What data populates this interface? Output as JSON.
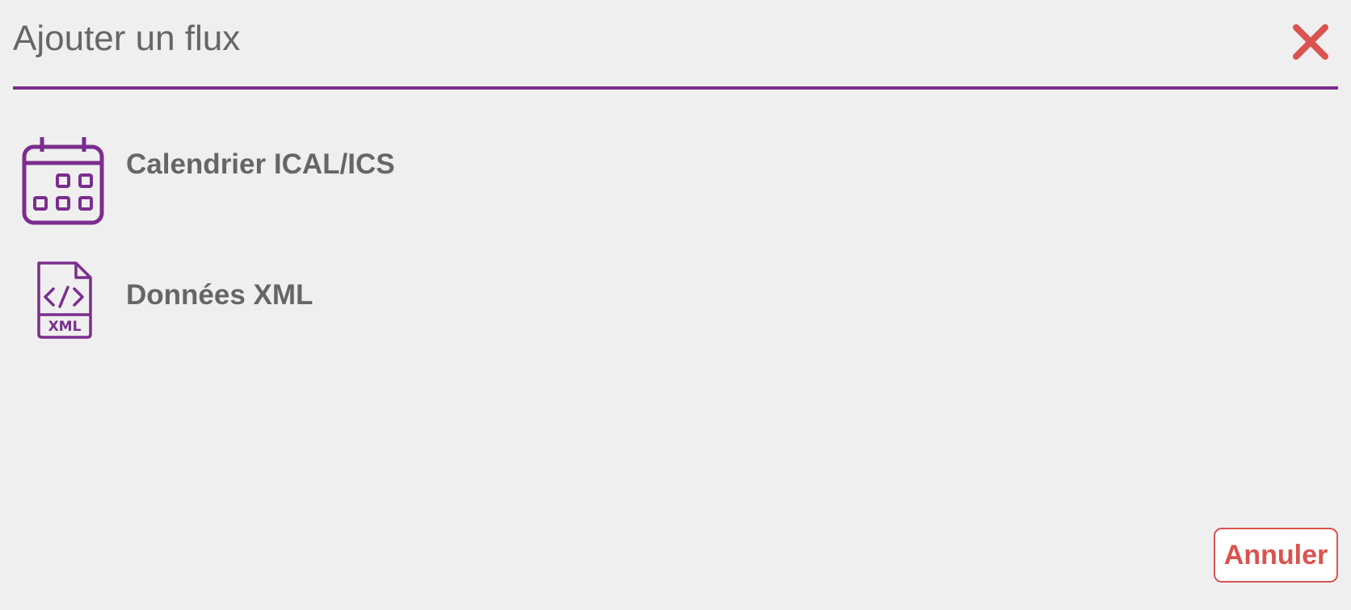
{
  "dialog": {
    "title": "Ajouter un flux",
    "close_icon": "close-icon"
  },
  "options": [
    {
      "label": "Calendrier ICAL/ICS",
      "icon": "calendar-icon"
    },
    {
      "label": "Données XML",
      "icon": "xml-file-icon",
      "icon_text": "XML"
    }
  ],
  "footer": {
    "cancel_label": "Annuler"
  },
  "colors": {
    "accent": "#7b2d8e",
    "danger": "#d9534f",
    "text": "#666666",
    "background": "#efefef"
  }
}
